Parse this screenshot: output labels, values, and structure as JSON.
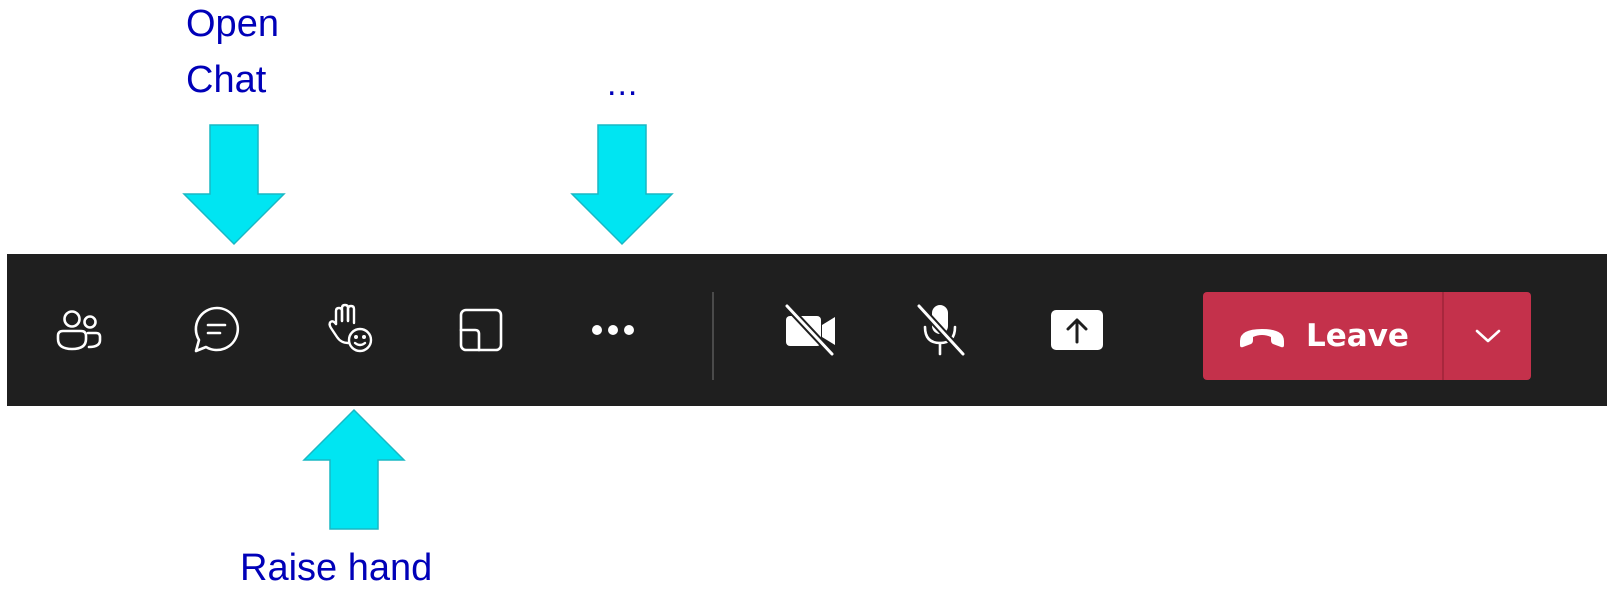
{
  "annotations": {
    "open_chat_line1": "Open",
    "open_chat_line2": "Chat",
    "more_options": "...",
    "raise_hand": "Raise hand",
    "text_color": "#0000b8",
    "arrow_color": "#00e5f2"
  },
  "toolbar": {
    "background_color": "#1f1f1f",
    "icons": [
      "people-icon",
      "chat-icon",
      "raise-hand-react-icon",
      "view-layout-icon",
      "more-options-icon",
      "camera-off-icon",
      "mic-off-icon",
      "share-screen-icon"
    ],
    "leave": {
      "label": "Leave",
      "color": "#c4314b",
      "icon": "phone-hangup-icon",
      "dropdown_icon": "chevron-down-icon"
    }
  }
}
